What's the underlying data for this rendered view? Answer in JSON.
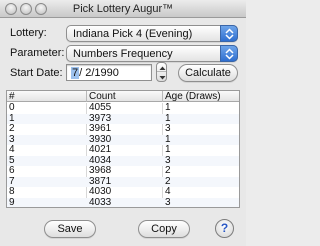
{
  "window": {
    "title": "Pick Lottery Augur™"
  },
  "form": {
    "lottery_label": "Lottery:",
    "lottery_value": "Indiana Pick 4 (Evening)",
    "parameter_label": "Parameter:",
    "parameter_value": "Numbers Frequency",
    "start_date_label": "Start Date:",
    "start_date_month": "7",
    "start_date_rest": "/  2/1990",
    "calculate_label": "Calculate"
  },
  "table": {
    "headers": [
      "#",
      "Count",
      "Age (Draws)"
    ],
    "rows": [
      [
        "0",
        "4055",
        "1"
      ],
      [
        "1",
        "3973",
        "1"
      ],
      [
        "2",
        "3961",
        "3"
      ],
      [
        "3",
        "3930",
        "1"
      ],
      [
        "4",
        "4021",
        "1"
      ],
      [
        "5",
        "4034",
        "3"
      ],
      [
        "6",
        "3968",
        "2"
      ],
      [
        "7",
        "3871",
        "2"
      ],
      [
        "8",
        "4030",
        "4"
      ],
      [
        "9",
        "4033",
        "3"
      ]
    ]
  },
  "footer": {
    "save_label": "Save",
    "copy_label": "Copy",
    "help_label": "?"
  },
  "colors": {
    "accent": "#2f6fd0",
    "selection": "#9cc1ee"
  }
}
